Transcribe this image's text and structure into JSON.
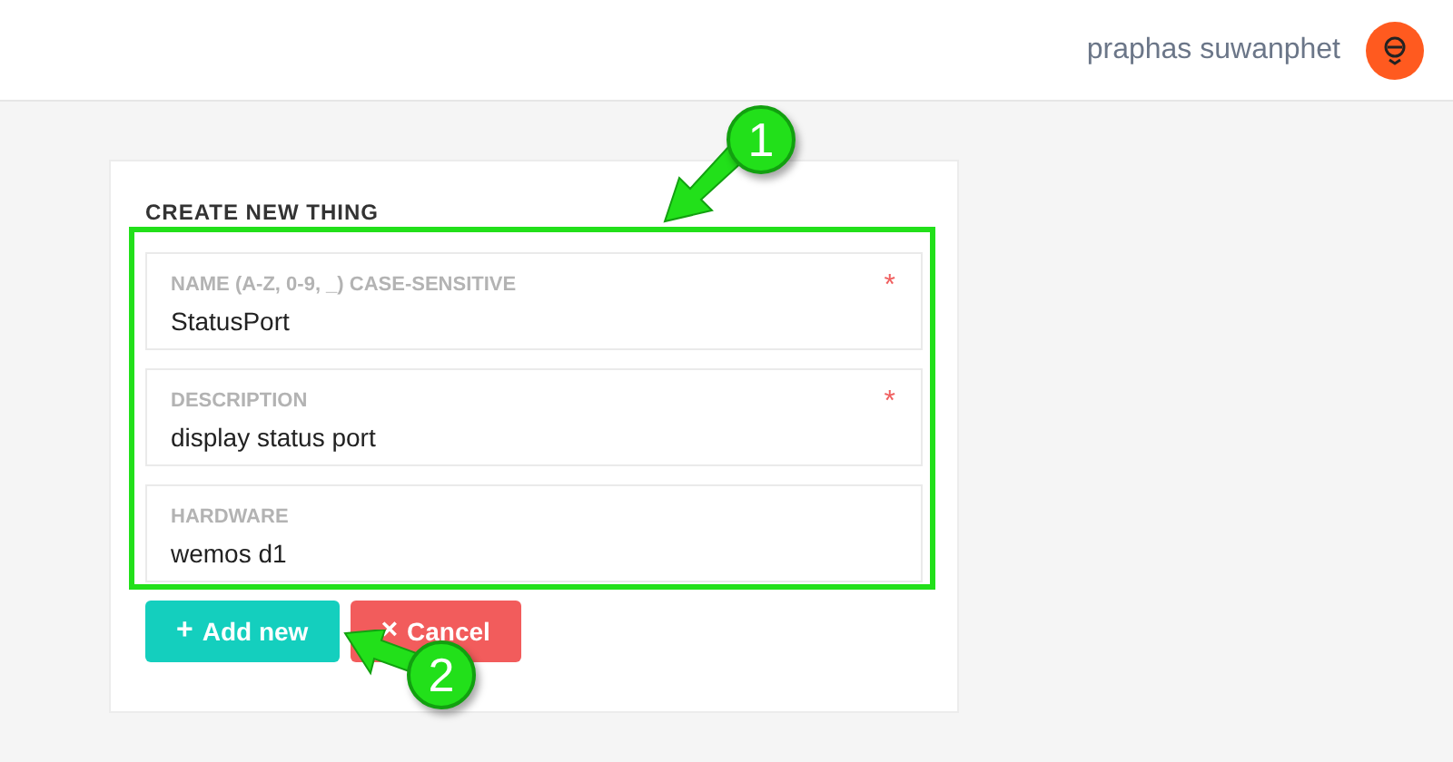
{
  "header": {
    "user_name": "praphas suwanphet"
  },
  "form": {
    "title": "CREATE NEW THING",
    "fields": [
      {
        "label": "NAME (A-Z, 0-9, _) CASE-SENSITIVE",
        "value": "StatusPort",
        "required_mark": "*"
      },
      {
        "label": "DESCRIPTION",
        "value": "display status port",
        "required_mark": "*"
      },
      {
        "label": "HARDWARE",
        "value": "wemos d1"
      }
    ],
    "buttons": [
      {
        "kind": "primary",
        "icon": "+",
        "label": "Add new"
      },
      {
        "kind": "danger",
        "icon": "×",
        "label": "Cancel"
      }
    ]
  },
  "annotations": [
    {
      "number": "1"
    },
    {
      "number": "2"
    }
  ]
}
